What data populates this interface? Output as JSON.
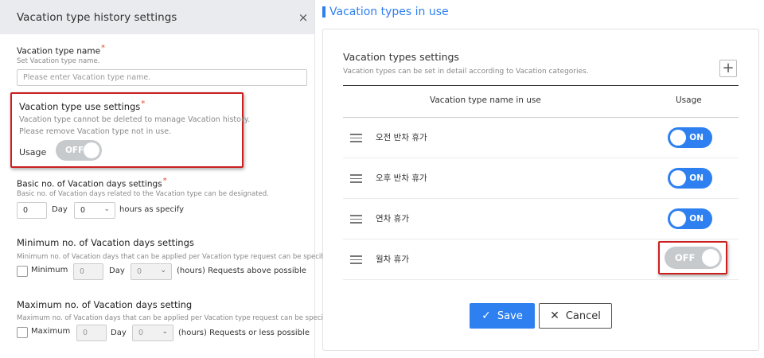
{
  "left_panel": {
    "title": "Vacation type history settings",
    "close_icon": "×",
    "name_field": {
      "label": "Vacation type name",
      "required_mark": "*",
      "hint": "Set Vacation type name.",
      "placeholder": "Please enter Vacation type name."
    },
    "use_settings": {
      "title": "Vacation type use settings",
      "required_mark": "*",
      "note1": "Vacation type cannot be deleted to manage Vacation history.",
      "note2": "Please remove Vacation type not in use.",
      "usage_label": "Usage",
      "toggle_label": "OFF"
    },
    "basic_days": {
      "title": "Basic no. of Vacation days settings",
      "required_mark": "*",
      "hint": "Basic no. of Vacation days related to the Vacation type can be designated.",
      "day_value": "0",
      "day_label": "Day",
      "hours_value": "0",
      "hours_suffix": "hours as specify"
    },
    "minimum": {
      "title": "Minimum no. of Vacation days settings",
      "hint": "Minimum no. of Vacation days that can be applied per Vacation type request can be specified.",
      "checkbox_label": "Minimum",
      "day_value": "0",
      "day_label": "Day",
      "hours_value": "0",
      "hours_suffix": "(hours) Requests above possible"
    },
    "maximum": {
      "title": "Maximum no. of Vacation days setting",
      "hint": "Maximum no. of Vacation days that can be applied per Vacation type request can be specified.",
      "checkbox_label": "Maximum",
      "day_value": "0",
      "day_label": "Day",
      "hours_value": "0",
      "hours_suffix": "(hours) Requests or less possible"
    }
  },
  "right_panel": {
    "title": "Vacation types in use",
    "card": {
      "title": "Vacation types settings",
      "subtitle": "Vacation types can be set in detail according to Vacation categories.",
      "plus_icon": "+",
      "columns": [
        "Vacation type name in use",
        "Usage"
      ],
      "rows": [
        {
          "name": "오전 반차 휴가",
          "usage": "ON"
        },
        {
          "name": "오후 반차 휴가",
          "usage": "ON"
        },
        {
          "name": "연차 휴가",
          "usage": "ON"
        },
        {
          "name": "월차 휴가",
          "usage": "OFF"
        }
      ],
      "save_label": "Save",
      "cancel_label": "Cancel"
    }
  },
  "colors": {
    "accent": "#2e80f0",
    "highlight": "#cc1f1f",
    "required": "#e54b2a",
    "toggle_off": "#c7cacd"
  }
}
